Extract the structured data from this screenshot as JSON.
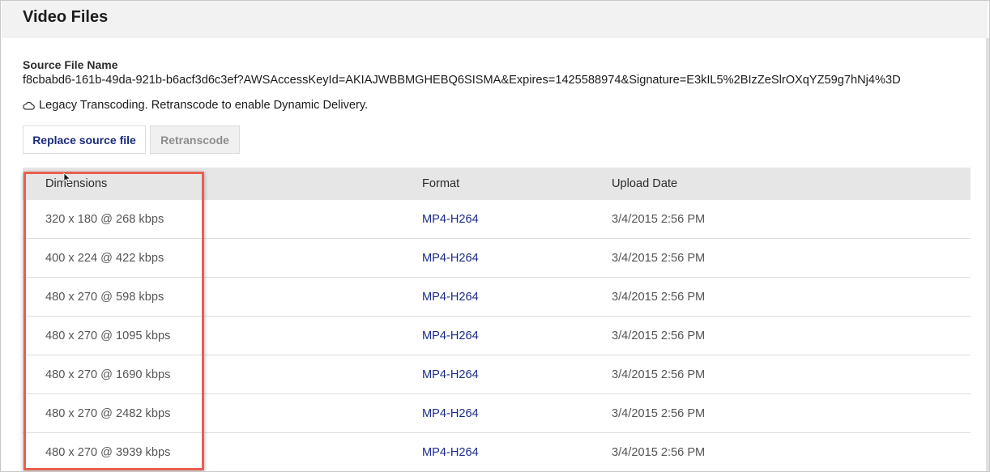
{
  "header": {
    "title": "Video Files"
  },
  "source": {
    "label": "Source File Name",
    "value": "f8cbabd6-161b-49da-921b-b6acf3d6c3ef?AWSAccessKeyId=AKIAJWBBMGHEBQ6SISMA&Expires=1425588974&Signature=E3kIL5%2BIzZeSlrOXqYZ59g7hNj4%3D"
  },
  "notice": {
    "icon": "cloud-icon",
    "text": "Legacy Transcoding. Retranscode to enable Dynamic Delivery."
  },
  "buttons": {
    "replace_label": "Replace source file",
    "retranscode_label": "Retranscode"
  },
  "table": {
    "columns": [
      "Dimensions",
      "Format",
      "Upload Date"
    ],
    "rows": [
      {
        "dimensions": "320 x 180 @ 268 kbps",
        "format": "MP4-H264",
        "upload_date": "3/4/2015 2:56 PM"
      },
      {
        "dimensions": "400 x 224 @ 422 kbps",
        "format": "MP4-H264",
        "upload_date": "3/4/2015 2:56 PM"
      },
      {
        "dimensions": "480 x 270 @ 598 kbps",
        "format": "MP4-H264",
        "upload_date": "3/4/2015 2:56 PM"
      },
      {
        "dimensions": "480 x 270 @ 1095 kbps",
        "format": "MP4-H264",
        "upload_date": "3/4/2015 2:56 PM"
      },
      {
        "dimensions": "480 x 270 @ 1690 kbps",
        "format": "MP4-H264",
        "upload_date": "3/4/2015 2:56 PM"
      },
      {
        "dimensions": "480 x 270 @ 2482 kbps",
        "format": "MP4-H264",
        "upload_date": "3/4/2015 2:56 PM"
      },
      {
        "dimensions": "480 x 270 @ 3939 kbps",
        "format": "MP4-H264",
        "upload_date": "3/4/2015 2:56 PM"
      }
    ]
  },
  "colors": {
    "highlight": "#e8604f",
    "link": "#1a2a8a",
    "header_bg": "#f2f2f2"
  }
}
